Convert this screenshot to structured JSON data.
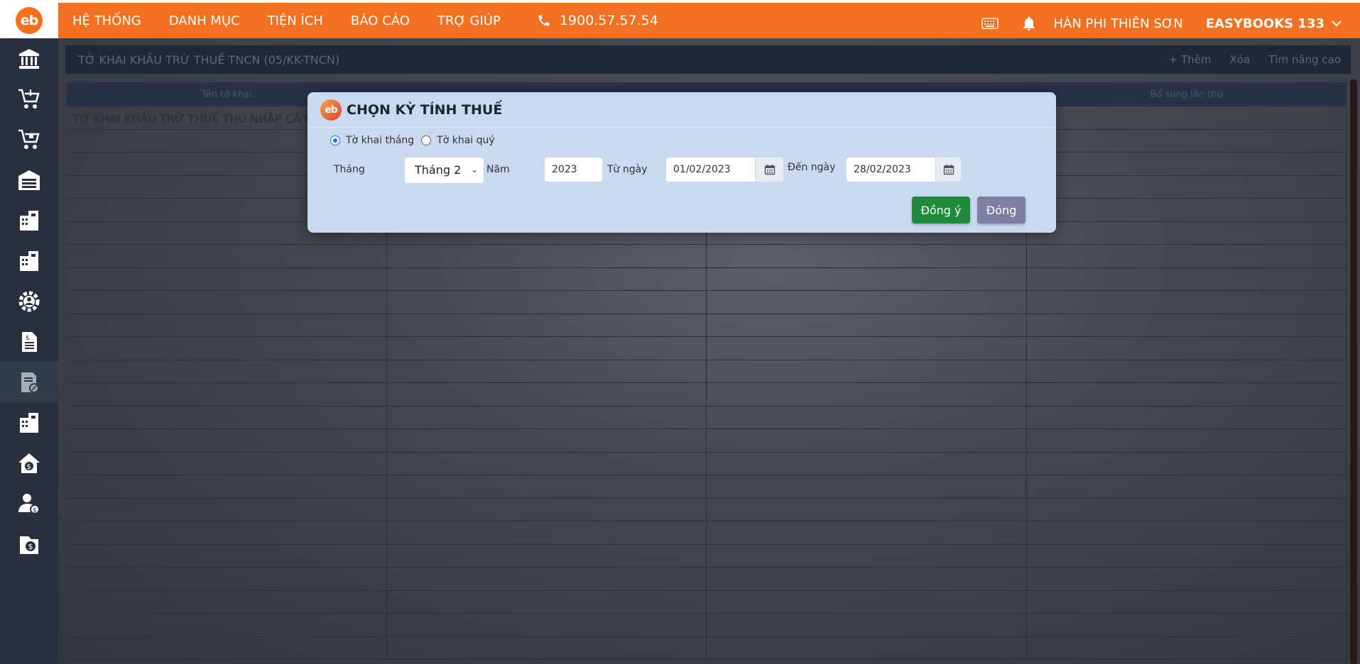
{
  "app": {
    "logo_text": "eb",
    "menu": [
      "HỆ THỐNG",
      "DANH MỤC",
      "TIỆN ÍCH",
      "BÁO CÁO",
      "TRỢ GIÚP"
    ],
    "phone": "1900.57.57.54",
    "user_name": "HÀN PHI THIÊN SƠN",
    "company": "EASYBOOKS 133",
    "brand_color": "#f37021"
  },
  "sidebar": {
    "icons": [
      "bank-icon",
      "cart-in-icon",
      "cart-out-icon",
      "warehouse-icon",
      "building-calc-icon",
      "building-calc-2-icon",
      "gear-user-icon",
      "document-dollar-icon",
      "tax-document-icon",
      "building-report-icon",
      "house-dollar-icon",
      "user-dollar-icon",
      "folder-dollar-icon"
    ],
    "active_index": 8
  },
  "panel": {
    "title": "TỜ KHAI KHẤU TRỪ THUẾ TNCN (05/KK-TNCN)",
    "actions": [
      "+ Thêm",
      "Xóa",
      "Tìm nâng cao"
    ],
    "columns": [
      "Tên tờ khai",
      "",
      "",
      "Bổ sung lần thứ"
    ],
    "rows": [
      [
        "TỜ KHAI KHẤU TRỪ THUẾ THU NHẬP CÁ N",
        "",
        "",
        ""
      ]
    ]
  },
  "modal": {
    "logo_text": "eb",
    "title": "CHỌN KỲ TÍNH THUẾ",
    "radio_monthly": "Tờ khai tháng",
    "radio_quarterly": "Tờ khai quý",
    "selected": "monthly",
    "label_month": "Tháng",
    "month_value": "Tháng 2",
    "label_year": "Năm",
    "year_value": "2023",
    "label_from": "Từ ngày",
    "from_value": "01/02/2023",
    "label_to": "Đến ngày",
    "to_value": "28/02/2023",
    "ok_label": "Đồng ý",
    "close_label": "Đóng",
    "ok_color": "#1e8a3c",
    "close_color": "#7d80a0"
  }
}
